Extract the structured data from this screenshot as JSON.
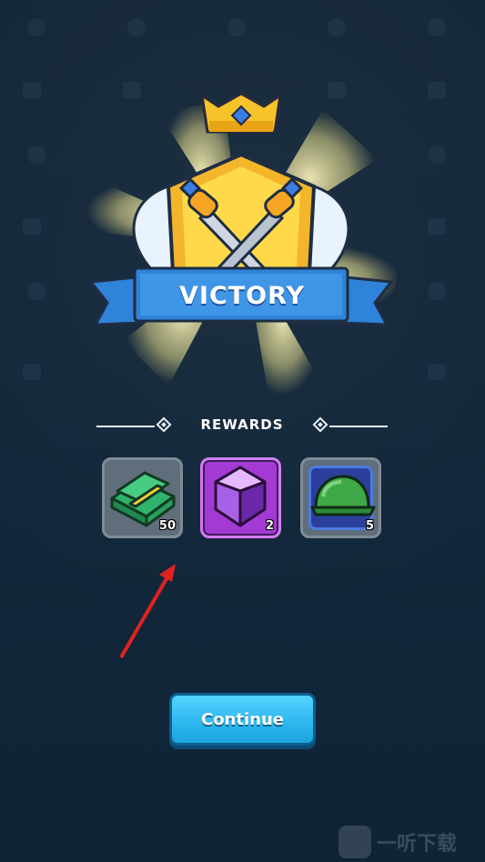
{
  "title": "VICTORY",
  "rewards": {
    "header": "REWARDS",
    "items": [
      {
        "name": "cash-icon",
        "count": "50"
      },
      {
        "name": "gem-icon",
        "count": "2"
      },
      {
        "name": "helmet-icon",
        "count": "5"
      }
    ]
  },
  "continue_button": "Continue",
  "watermark": "一听下载",
  "colors": {
    "background": "#142a3d",
    "banner": "#2f83d8",
    "button": "#2cb6ee",
    "gem_tile": "#a43ad4",
    "arrow": "#e0231f"
  }
}
